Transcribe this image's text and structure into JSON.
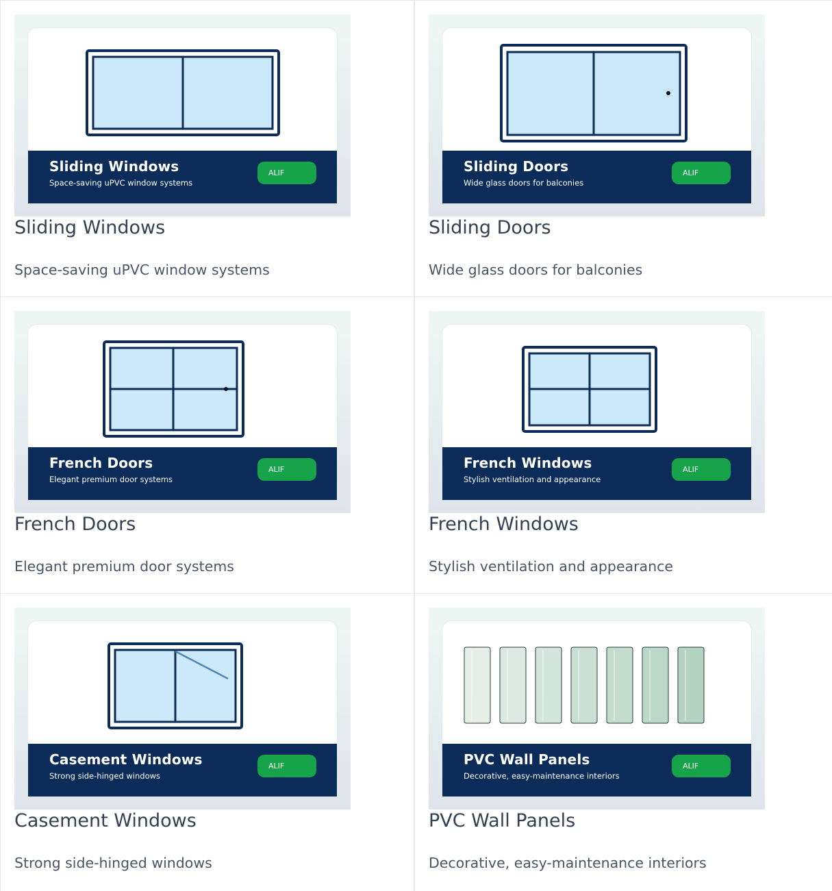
{
  "products": [
    {
      "title": "Sliding Windows",
      "subtitle": "Space-saving uPVC window systems",
      "brand": "ALIF",
      "icon": "sliding-window-icon"
    },
    {
      "title": "Sliding Doors",
      "subtitle": "Wide glass doors for balconies",
      "brand": "ALIF",
      "icon": "sliding-door-icon"
    },
    {
      "title": "French Doors",
      "subtitle": "Elegant premium door systems",
      "brand": "ALIF",
      "icon": "french-door-icon"
    },
    {
      "title": "French Windows",
      "subtitle": "Stylish ventilation and appearance",
      "brand": "ALIF",
      "icon": "french-window-icon"
    },
    {
      "title": "Casement Windows",
      "subtitle": "Strong side-hinged windows",
      "brand": "ALIF",
      "icon": "casement-window-icon"
    },
    {
      "title": "PVC Wall Panels",
      "subtitle": "Decorative, easy-maintenance interiors",
      "brand": "ALIF",
      "icon": "wall-panels-icon"
    }
  ],
  "colors": {
    "navy": "#0b2c59",
    "glass": "#cce8fb",
    "brand_green": "#16a34a"
  }
}
